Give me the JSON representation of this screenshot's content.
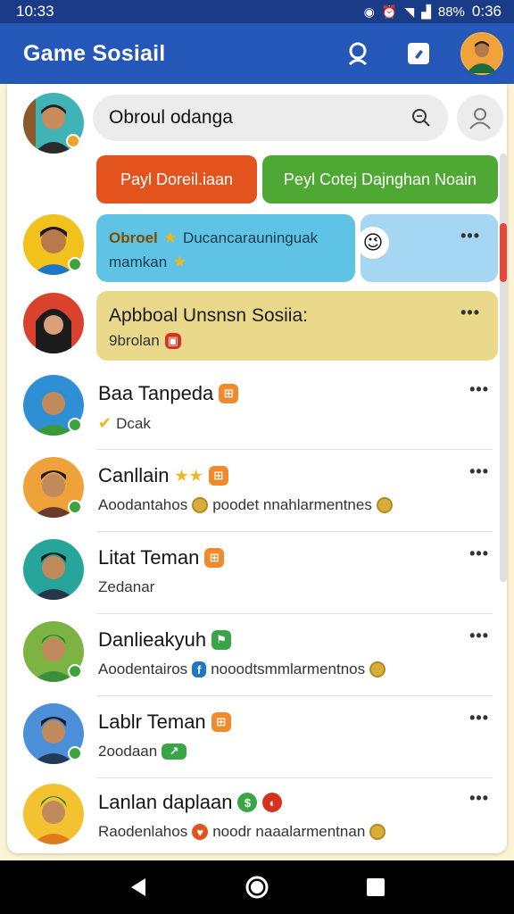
{
  "status": {
    "time": "10:33",
    "battery": "88%",
    "clock_right": "0:36"
  },
  "app": {
    "title": "Game Sosiail"
  },
  "search": {
    "value": "Obroul odanga"
  },
  "buttons": {
    "left": "Payl Doreil.iaan",
    "right": "Peyl Cotej Dajnghan Noain"
  },
  "bubbles": {
    "blue": {
      "title": "Obroel",
      "text": "Ducancarauninguak",
      "line2": "mamkan"
    },
    "yellow": {
      "title": "Apbboal Unsnsn Sosiia:",
      "sub": "9brolan"
    }
  },
  "contacts": [
    {
      "name": "Baa Tanpeda",
      "sub": "Dcak"
    },
    {
      "name": "Canllain",
      "sub": "Aoodantahos",
      "sub2": "poodet nnahlarmentnes"
    },
    {
      "name": "Litat Teman",
      "sub": "Zedanar"
    },
    {
      "name": "Danlieakyuh",
      "sub": "Aoodentairos",
      "sub2": "nooodtsmmlarmentnos"
    },
    {
      "name": "Lablr Teman",
      "sub": "2oodaan"
    },
    {
      "name": "Lanlan daplaan",
      "sub": "Raodenlahos",
      "sub2": "noodr naaalarmentnan"
    }
  ],
  "icons": {
    "search": "search-icon",
    "edit": "edit-icon",
    "add_friend": "add-friend-icon",
    "more": "more-icon",
    "back": "back-icon",
    "home": "home-icon",
    "recents": "recents-icon"
  },
  "colors": {
    "appbar": "#2457b8",
    "status": "#1a3c86",
    "red_button": "#e2531d",
    "green_button": "#4fa833",
    "blue_bubble": "#5ec3e4",
    "yellow_bubble": "#ead98a",
    "background": "#fbf3d5"
  }
}
